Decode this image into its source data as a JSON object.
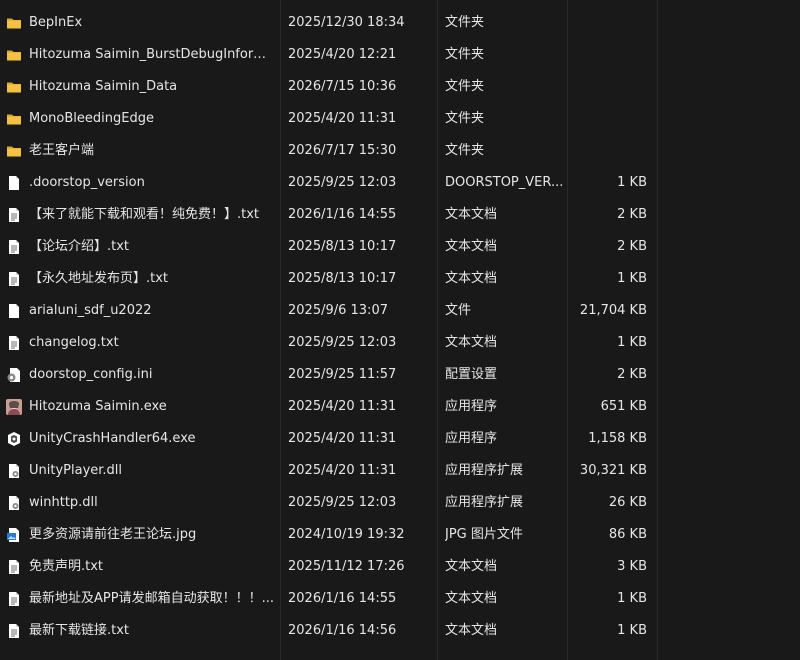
{
  "files": [
    {
      "name": "BepInEx",
      "date": "2025/12/30 18:34",
      "type": "文件夹",
      "size": "",
      "icon": "folder-icon"
    },
    {
      "name": "Hitozuma Saimin_BurstDebugInform...",
      "date": "2025/4/20 12:21",
      "type": "文件夹",
      "size": "",
      "icon": "folder-icon"
    },
    {
      "name": "Hitozuma Saimin_Data",
      "date": "2026/7/15 10:36",
      "type": "文件夹",
      "size": "",
      "icon": "folder-icon"
    },
    {
      "name": "MonoBleedingEdge",
      "date": "2025/4/20 11:31",
      "type": "文件夹",
      "size": "",
      "icon": "folder-icon"
    },
    {
      "name": "老王客户端",
      "date": "2026/7/17 15:30",
      "type": "文件夹",
      "size": "",
      "icon": "folder-icon"
    },
    {
      "name": ".doorstop_version",
      "date": "2025/9/25 12:03",
      "type": "DOORSTOP_VER...",
      "size": "1 KB",
      "icon": "file-icon"
    },
    {
      "name": "【来了就能下载和观看！纯免费！】.txt",
      "date": "2026/1/16 14:55",
      "type": "文本文档",
      "size": "2 KB",
      "icon": "text-file-icon"
    },
    {
      "name": "【论坛介绍】.txt",
      "date": "2025/8/13 10:17",
      "type": "文本文档",
      "size": "2 KB",
      "icon": "text-file-icon"
    },
    {
      "name": "【永久地址发布页】.txt",
      "date": "2025/8/13 10:17",
      "type": "文本文档",
      "size": "1 KB",
      "icon": "text-file-icon"
    },
    {
      "name": "arialuni_sdf_u2022",
      "date": "2025/9/6 13:07",
      "type": "文件",
      "size": "21,704 KB",
      "icon": "file-icon"
    },
    {
      "name": "changelog.txt",
      "date": "2025/9/25 12:03",
      "type": "文本文档",
      "size": "1 KB",
      "icon": "text-file-icon"
    },
    {
      "name": "doorstop_config.ini",
      "date": "2025/9/25 11:57",
      "type": "配置设置",
      "size": "2 KB",
      "icon": "config-file-icon"
    },
    {
      "name": "Hitozuma Saimin.exe",
      "date": "2025/4/20 11:31",
      "type": "应用程序",
      "size": "651 KB",
      "icon": "app-icon"
    },
    {
      "name": "UnityCrashHandler64.exe",
      "date": "2025/4/20 11:31",
      "type": "应用程序",
      "size": "1,158 KB",
      "icon": "crash-handler-icon"
    },
    {
      "name": "UnityPlayer.dll",
      "date": "2025/4/20 11:31",
      "type": "应用程序扩展",
      "size": "30,321 KB",
      "icon": "dll-file-icon"
    },
    {
      "name": "winhttp.dll",
      "date": "2025/9/25 12:03",
      "type": "应用程序扩展",
      "size": "26 KB",
      "icon": "dll-file-icon"
    },
    {
      "name": "更多资源请前往老王论坛.jpg",
      "date": "2024/10/19 19:32",
      "type": "JPG 图片文件",
      "size": "86 KB",
      "icon": "image-file-icon"
    },
    {
      "name": "免责声明.txt",
      "date": "2025/11/12 17:26",
      "type": "文本文档",
      "size": "3 KB",
      "icon": "text-file-icon"
    },
    {
      "name": "最新地址及APP请发邮箱自动获取！！！...",
      "date": "2026/1/16 14:55",
      "type": "文本文档",
      "size": "1 KB",
      "icon": "text-file-icon"
    },
    {
      "name": "最新下载链接.txt",
      "date": "2026/1/16 14:56",
      "type": "文本文档",
      "size": "1 KB",
      "icon": "text-file-icon"
    }
  ],
  "colors": {
    "background": "#191919",
    "text": "#e6e6e6",
    "folder": "#f3c244",
    "folder_dark": "#dca52c"
  }
}
